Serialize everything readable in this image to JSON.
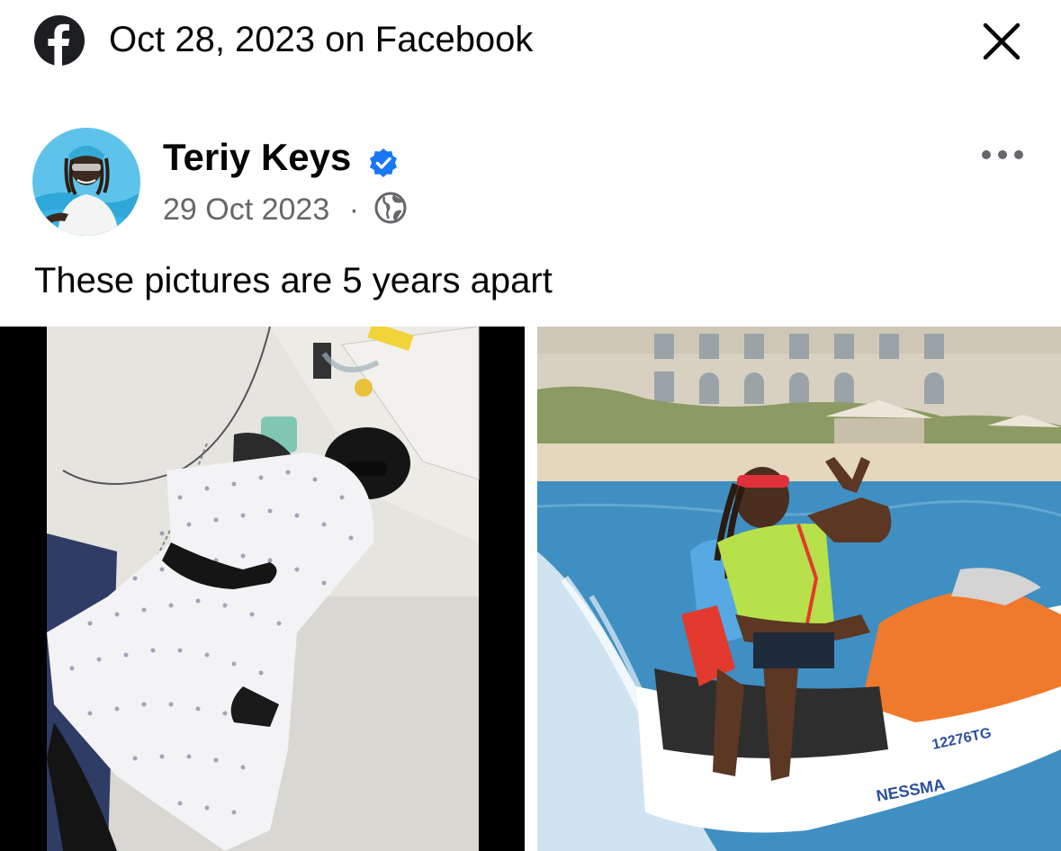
{
  "topbar": {
    "title": "Oct 28, 2023 on Facebook",
    "logo_icon": "facebook-logo-icon",
    "close_icon": "close-icon"
  },
  "post": {
    "author": "Teriy Keys",
    "verified_icon": "verified-badge-icon",
    "date": "29 Oct 2023",
    "separator": "·",
    "audience_icon": "globe-icon",
    "more_icon": "more-options-icon",
    "caption": "These pictures are 5 years apart"
  },
  "photos": [
    {
      "description_icon": "hospital-photo"
    },
    {
      "description_icon": "jetski-photo",
      "jetski_registration": "12276TG",
      "jetski_name": "NESSMA"
    }
  ],
  "colors": {
    "facebook_dark": "#1c1e21",
    "verified_blue": "#1877f2",
    "meta_gray": "#65676b"
  }
}
